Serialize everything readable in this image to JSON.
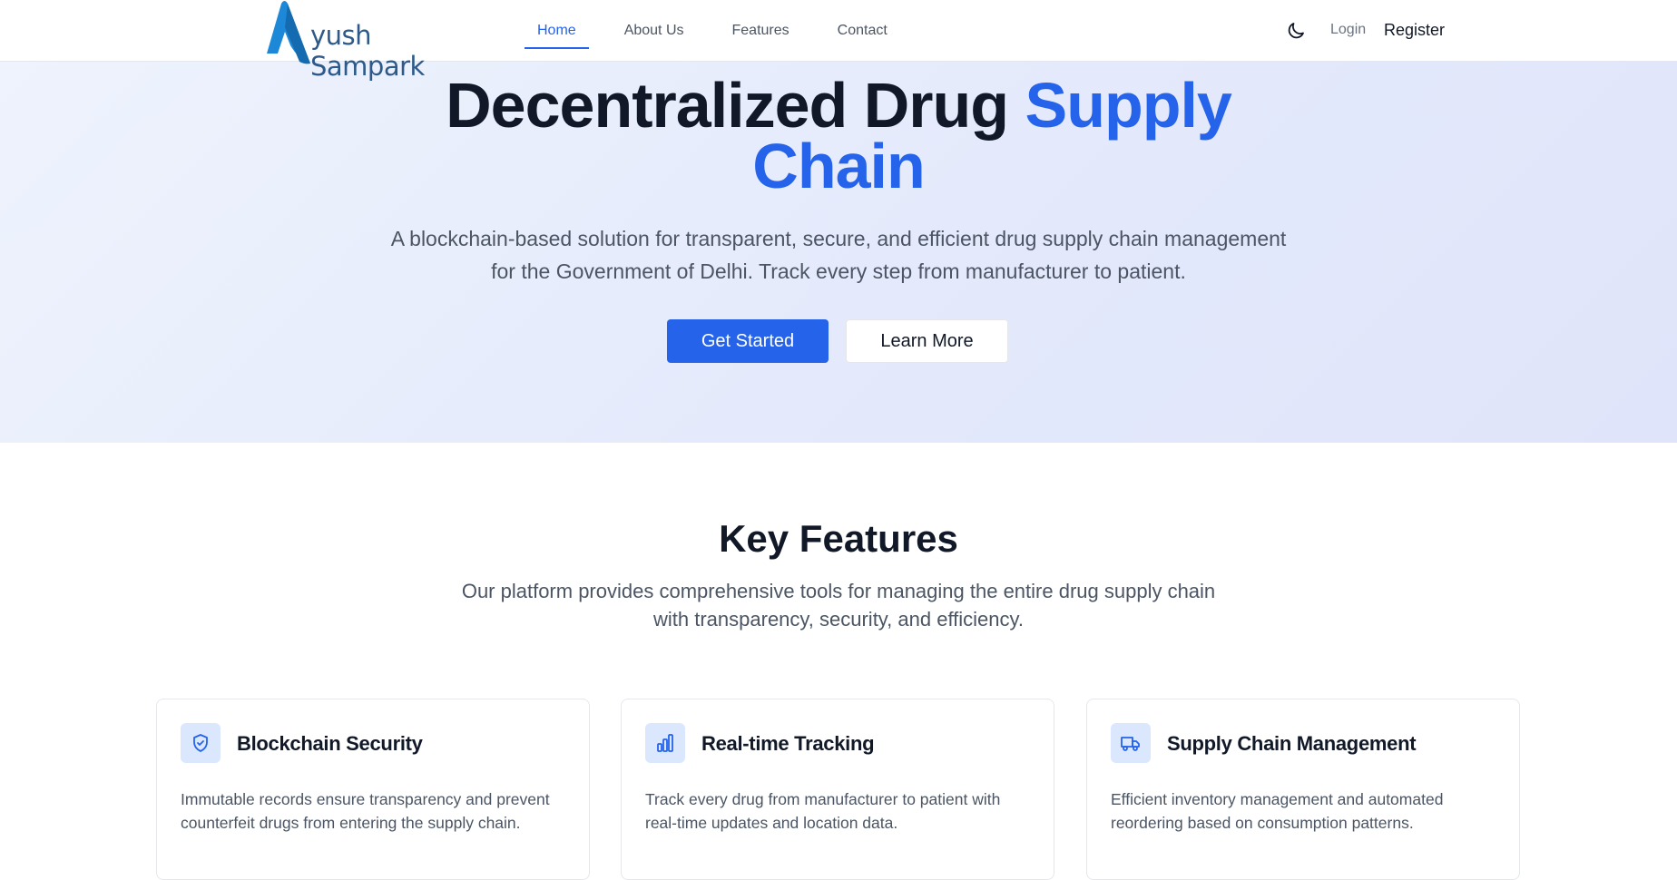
{
  "brand": {
    "name": "yush Sampark",
    "logo_letter": "A"
  },
  "nav": {
    "links": [
      {
        "label": "Home",
        "active": true
      },
      {
        "label": "About Us",
        "active": false
      },
      {
        "label": "Features",
        "active": false
      },
      {
        "label": "Contact",
        "active": false
      }
    ],
    "theme_icon": "moon-icon",
    "login_label": "Login",
    "register_label": "Register"
  },
  "hero": {
    "title_part1": "Decentralized Drug ",
    "title_accent_line1": "Supply",
    "title_accent_line2": "Chain",
    "subtitle": "A blockchain-based solution for transparent, secure, and efficient drug supply chain management for the Government of Delhi. Track every step from manufacturer to patient.",
    "primary_button": "Get Started",
    "secondary_button": "Learn More"
  },
  "features": {
    "title": "Key Features",
    "subtitle": "Our platform provides comprehensive tools for managing the entire drug supply chain with transparency, security, and efficiency.",
    "cards": [
      {
        "icon": "shield-check-icon",
        "title": "Blockchain Security",
        "description": "Immutable records ensure transparency and prevent counterfeit drugs from entering the supply chain."
      },
      {
        "icon": "bar-chart-icon",
        "title": "Real-time Tracking",
        "description": "Track every drug from manufacturer to patient with real-time updates and location data."
      },
      {
        "icon": "truck-icon",
        "title": "Supply Chain Management",
        "description": "Efficient inventory management and automated reordering based on consumption patterns."
      }
    ]
  },
  "colors": {
    "accent": "#2563eb",
    "brand": "#2d5a8a",
    "hero_bg": "#e6ecfb",
    "icon_bg": "#dbe7fd"
  }
}
